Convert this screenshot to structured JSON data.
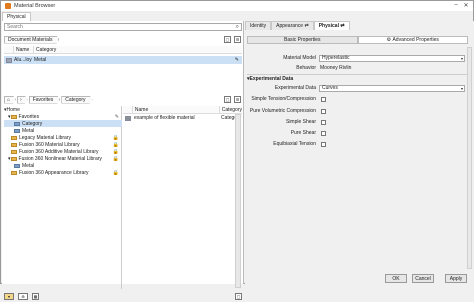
{
  "window": {
    "title": "Material Browser",
    "tab": "Physical"
  },
  "search": {
    "placeholder": "Search"
  },
  "document_materials": {
    "crumb": "Document Materials",
    "headers": [
      "Name",
      "Category"
    ],
    "rows": [
      {
        "name": "Alu...loy",
        "category": "Metal"
      }
    ]
  },
  "library_crumbs": [
    "Favorites",
    "Category"
  ],
  "tree": {
    "home": "Home",
    "items": [
      {
        "label": "Favorites",
        "indent": 1,
        "locked": false
      },
      {
        "label": "Category",
        "indent": 2,
        "locked": false,
        "selected": true
      },
      {
        "label": "Metal",
        "indent": 2,
        "locked": false
      },
      {
        "label": "Legacy Material Library",
        "indent": 1,
        "locked": true
      },
      {
        "label": "Fusion 360 Material Library",
        "indent": 1,
        "locked": true
      },
      {
        "label": "Fusion 360 Additive Material Library",
        "indent": 1,
        "locked": true
      },
      {
        "label": "Fusion 360 Nonlinear Material Library",
        "indent": 1,
        "locked": true
      },
      {
        "label": "Metal",
        "indent": 2,
        "locked": false
      },
      {
        "label": "Fusion 360 Appearance Library",
        "indent": 1,
        "locked": true
      }
    ]
  },
  "list": {
    "headers": [
      "Name",
      "Category"
    ],
    "rows": [
      {
        "name": "example of flexible material",
        "category": "Category"
      }
    ]
  },
  "right_tabs": [
    "Identity",
    "Appearance",
    "Physical"
  ],
  "prop_tabs": [
    "Basic Properties",
    "Advanced Properties"
  ],
  "properties": {
    "material_model_label": "Material Model",
    "material_model_value": "Hyperelastic",
    "behavior_label": "Behavior",
    "behavior_value": "Mooney Rivlin",
    "section_title": "Experimental Data",
    "experimental_data_label": "Experimental Data",
    "experimental_data_value": "Curves",
    "checks": [
      "Simple Tension/Compression",
      "Pure Volumetric Compression",
      "Simple Shear",
      "Pure Shear",
      "Equibiaxial Tension"
    ]
  },
  "buttons": {
    "ok": "OK",
    "cancel": "Cancel",
    "apply": "Apply"
  },
  "colors": {
    "selection": "#cce0f5",
    "folder": "#e8b64a",
    "accent_icon": "#e07a1f"
  }
}
